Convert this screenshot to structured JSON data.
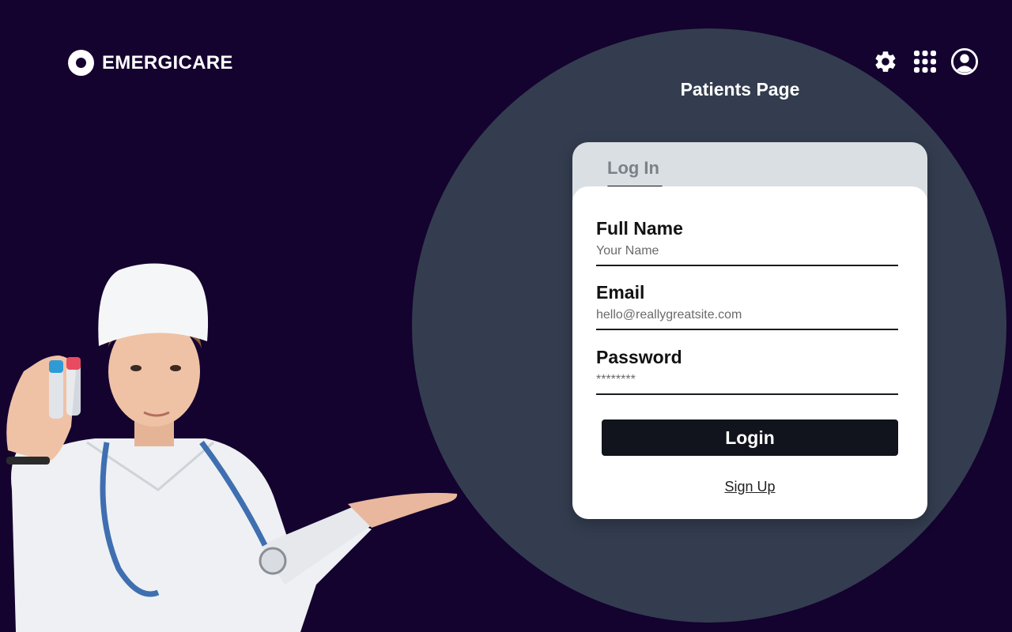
{
  "brand": {
    "name": "EMERGICARE",
    "logo_icon": "ring-logo-icon"
  },
  "header": {
    "page_title": "Patients Page",
    "icons": [
      "gear-icon",
      "apps-grid-icon",
      "user-account-icon"
    ]
  },
  "login_card": {
    "tab_label": "Log In",
    "fields": [
      {
        "label": "Full Name",
        "placeholder": "Your Name"
      },
      {
        "label": "Email",
        "placeholder": "hello@reallygreatsite.com"
      },
      {
        "label": "Password",
        "placeholder": "********"
      }
    ],
    "login_button": "Login",
    "signup_link": "Sign Up"
  },
  "colors": {
    "background": "#14022f",
    "circle": "#333d4f",
    "card_tab_bg": "#dadfe3",
    "button": "#11141c"
  }
}
